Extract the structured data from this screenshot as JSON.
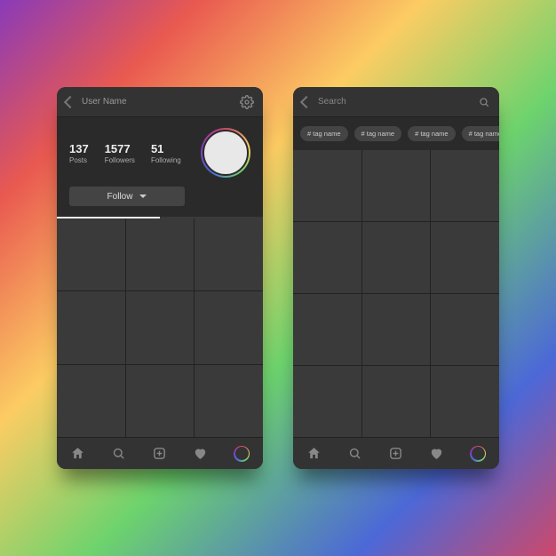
{
  "profile": {
    "header_title": "User Name",
    "stats": {
      "posts": {
        "value": "137",
        "label": "Posts"
      },
      "followers": {
        "value": "1577",
        "label": "Followers"
      },
      "following": {
        "value": "51",
        "label": "Following"
      }
    },
    "follow_button": "Follow"
  },
  "search": {
    "placeholder": "Search",
    "tags": [
      "#  tag name",
      "#  tag name",
      "#  tag name",
      "#  tag name"
    ]
  },
  "icons": {
    "back": "back-arrow-icon",
    "settings": "gear-icon",
    "search": "search-icon",
    "home": "home-icon",
    "add": "add-icon",
    "heart": "heart-icon",
    "profile_ring": "avatar-ring-icon"
  }
}
